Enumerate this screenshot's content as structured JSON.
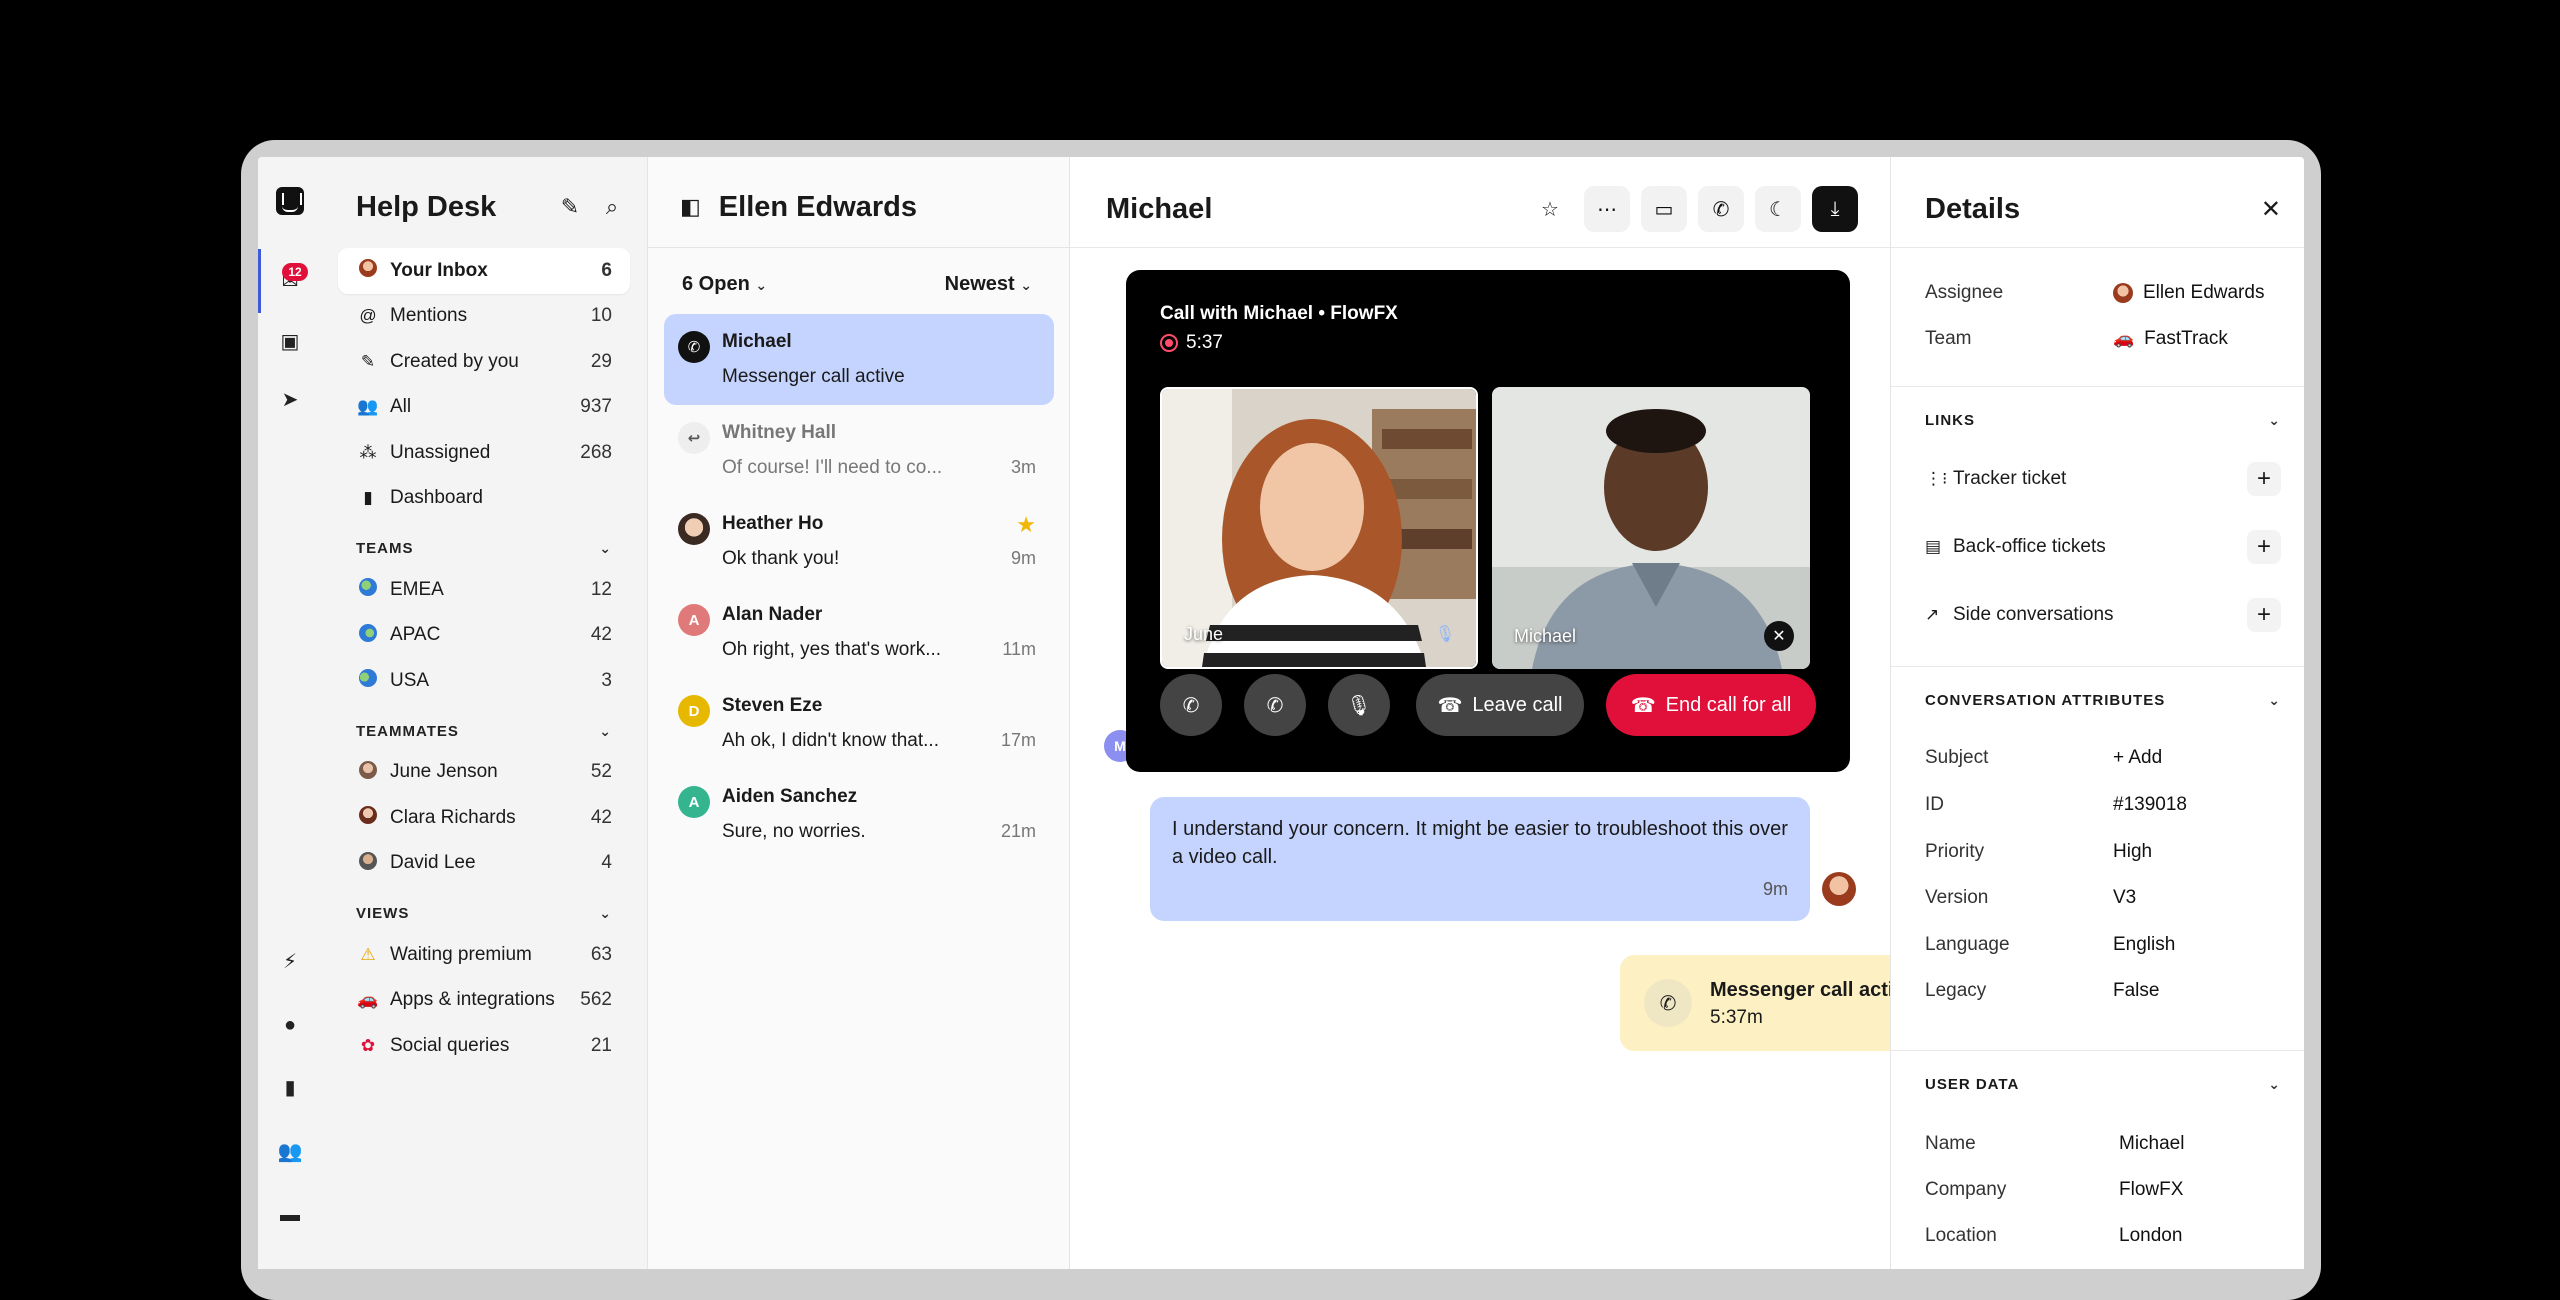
{
  "rail": {
    "badge": "12"
  },
  "nav": {
    "title": "Help Desk",
    "items": [
      {
        "label": "Your Inbox",
        "count": "6"
      },
      {
        "label": "Mentions",
        "count": "10"
      },
      {
        "label": "Created by you",
        "count": "29"
      },
      {
        "label": "All",
        "count": "937"
      },
      {
        "label": "Unassigned",
        "count": "268"
      },
      {
        "label": "Dashboard",
        "count": ""
      }
    ],
    "teams_label": "TEAMS",
    "teams": [
      {
        "label": "EMEA",
        "count": "12"
      },
      {
        "label": "APAC",
        "count": "42"
      },
      {
        "label": "USA",
        "count": "3"
      }
    ],
    "teammates_label": "TEAMMATES",
    "teammates": [
      {
        "label": "June Jenson",
        "count": "52"
      },
      {
        "label": "Clara Richards",
        "count": "42"
      },
      {
        "label": "David Lee",
        "count": "4"
      }
    ],
    "views_label": "VIEWS",
    "views": [
      {
        "label": "Waiting premium",
        "count": "63"
      },
      {
        "label": "Apps & integrations",
        "count": "562"
      },
      {
        "label": "Social queries",
        "count": "21"
      }
    ]
  },
  "convlist": {
    "owner": "Ellen Edwards",
    "filter": "6 Open",
    "sort": "Newest",
    "items": [
      {
        "name": "Michael",
        "preview": "Messenger call active",
        "time": ""
      },
      {
        "name": "Whitney Hall",
        "preview": "Of course! I'll need to co...",
        "time": "3m"
      },
      {
        "name": "Heather Ho",
        "preview": "Ok thank you!",
        "time": "9m"
      },
      {
        "name": "Alan Nader",
        "initial": "A",
        "preview": "Oh right, yes that's work...",
        "time": "11m"
      },
      {
        "name": "Steven Eze",
        "initial": "D",
        "preview": "Ah ok, I didn't know that...",
        "time": "17m"
      },
      {
        "name": "Aiden Sanchez",
        "initial": "A",
        "preview": "Sure, no worries.",
        "time": "21m"
      }
    ]
  },
  "main": {
    "title": "Michael",
    "call": {
      "title": "Call with Michael • FlowFX",
      "timer": "5:37",
      "tile_left_name": "June",
      "tile_right_name": "Michael",
      "leave_label": "Leave call",
      "end_label": "End call for all"
    },
    "left_avatar_initial": "M",
    "message": "I understand your concern. It might be easier to troubleshoot this over a video call.",
    "message_time": "9m",
    "call_status": "Messenger call active • Recording",
    "call_status_time": "5:37m"
  },
  "details": {
    "title": "Details",
    "assignee_label": "Assignee",
    "assignee": "Ellen Edwards",
    "team_label": "Team",
    "team": "FastTrack",
    "links_label": "LINKS",
    "links": [
      "Tracker ticket",
      "Back-office tickets",
      "Side conversations"
    ],
    "attrs_label": "CONVERSATION ATTRIBUTES",
    "attrs": [
      {
        "k": "Subject",
        "v": "+ Add"
      },
      {
        "k": "ID",
        "v": "#139018"
      },
      {
        "k": "Priority",
        "v": "High"
      },
      {
        "k": "Version",
        "v": "V3"
      },
      {
        "k": "Language",
        "v": "English"
      },
      {
        "k": "Legacy",
        "v": "False"
      }
    ],
    "user_label": "USER DATA",
    "user": [
      {
        "k": "Name",
        "v": "Michael"
      },
      {
        "k": "Company",
        "v": "FlowFX"
      },
      {
        "k": "Location",
        "v": "London"
      }
    ]
  },
  "colors": {
    "accent": "#c5d4ff",
    "danger": "#e0103a",
    "recording": "#fdf1c4"
  }
}
